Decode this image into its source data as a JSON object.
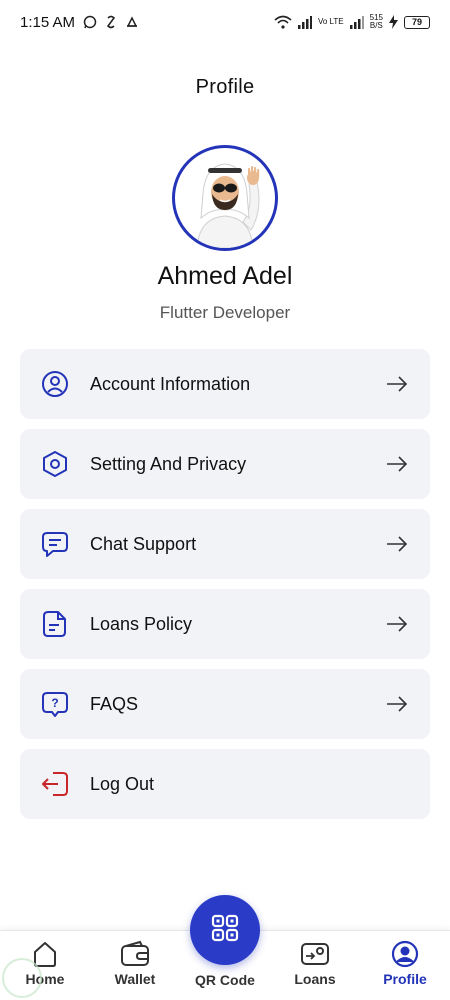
{
  "status_bar": {
    "time": "1:15 AM",
    "net_speed_value": "515",
    "net_speed_unit": "B/S",
    "network_label": "Vo LTE",
    "battery_level": "79"
  },
  "header": {
    "title": "Profile"
  },
  "profile": {
    "name": "Ahmed Adel",
    "role": "Flutter Developer"
  },
  "menu": {
    "items": [
      {
        "label": "Account Information",
        "icon": "user-circle-icon"
      },
      {
        "label": "Setting And Privacy",
        "icon": "hexagon-settings-icon"
      },
      {
        "label": "Chat Support",
        "icon": "chat-bubble-icon"
      },
      {
        "label": "Loans Policy",
        "icon": "document-icon"
      },
      {
        "label": "FAQS",
        "icon": "question-bubble-icon"
      },
      {
        "label": "Log Out",
        "icon": "logout-icon"
      }
    ]
  },
  "bottom_nav": {
    "home": "Home",
    "wallet": "Wallet",
    "qr": "QR Code",
    "loans": "Loans",
    "profile": "Profile",
    "active": "profile"
  },
  "colors": {
    "accent": "#2334b8",
    "menu_bg": "#f2f3f7",
    "logout_red": "#c62828"
  }
}
